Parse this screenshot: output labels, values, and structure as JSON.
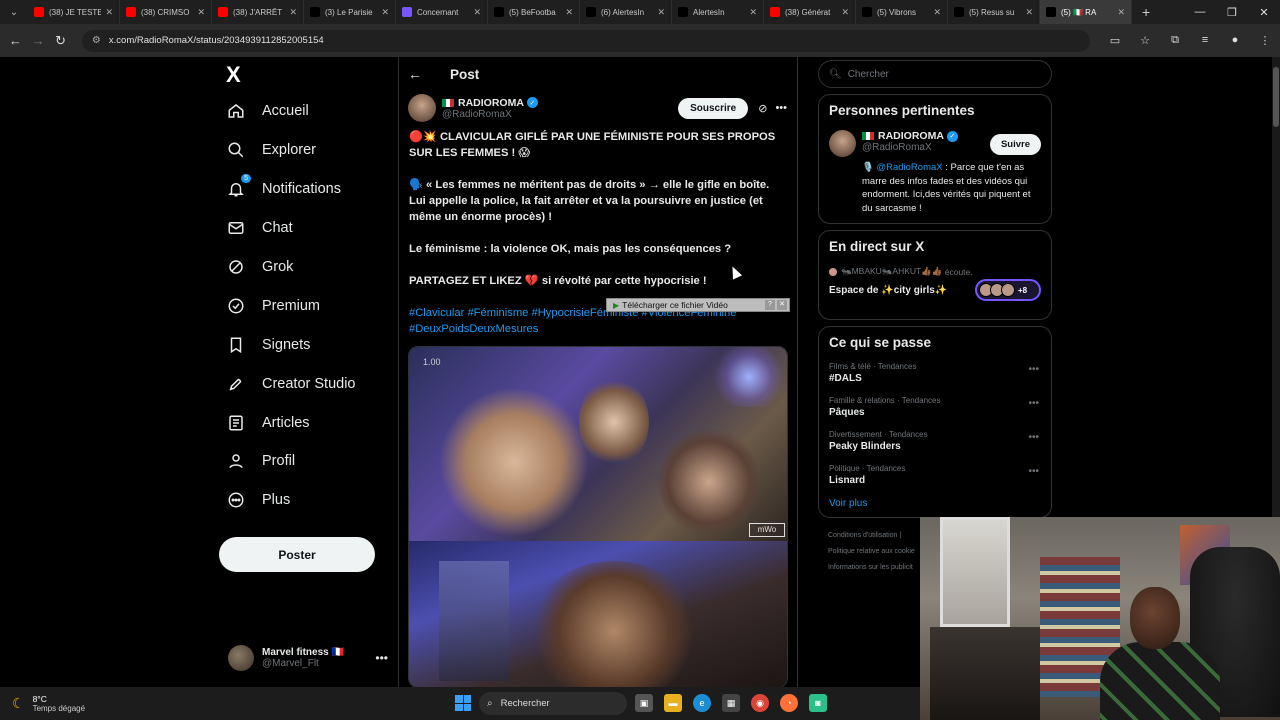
{
  "browser": {
    "tabs": [
      {
        "title": "(38) JE TESTE",
        "favicon_color": "#ff0000"
      },
      {
        "title": "(38) CRIMSO",
        "favicon_color": "#ff0000"
      },
      {
        "title": "(38) J'ARRÊT",
        "favicon_color": "#ff0000"
      },
      {
        "title": "(3) Le Parisie",
        "favicon_color": "#000000"
      },
      {
        "title": "Concernant",
        "favicon_color": "#7856ff"
      },
      {
        "title": "(5) BeFootba",
        "favicon_color": "#000000"
      },
      {
        "title": "(6) AlertesIn",
        "favicon_color": "#000000"
      },
      {
        "title": "AlertesIn",
        "favicon_color": "#000000"
      },
      {
        "title": "(38) Générat",
        "favicon_color": "#ff0000"
      },
      {
        "title": "(5) Vibrons",
        "favicon_color": "#000000"
      },
      {
        "title": "(5) Resus su",
        "favicon_color": "#000000"
      },
      {
        "title": "(5) 🇮🇹 RA",
        "favicon_color": "#000000",
        "active": true
      }
    ],
    "url": "x.com/RadioRomaX/status/2034939112852005154"
  },
  "nav": {
    "logo": "X",
    "items": [
      {
        "label": "Accueil",
        "icon": "home-icon"
      },
      {
        "label": "Explorer",
        "icon": "search-icon"
      },
      {
        "label": "Notifications",
        "icon": "bell-icon",
        "badge": "5"
      },
      {
        "label": "Chat",
        "icon": "mail-icon"
      },
      {
        "label": "Grok",
        "icon": "grok-icon"
      },
      {
        "label": "Premium",
        "icon": "premium-icon"
      },
      {
        "label": "Signets",
        "icon": "bookmark-icon"
      },
      {
        "label": "Creator Studio",
        "icon": "rocket-icon"
      },
      {
        "label": "Articles",
        "icon": "article-icon"
      },
      {
        "label": "Profil",
        "icon": "person-icon"
      },
      {
        "label": "Plus",
        "icon": "more-circle-icon"
      }
    ],
    "post_button": "Poster",
    "account": {
      "name": "Marvel fitness 🇫🇷",
      "handle": "@Marvel_Flt"
    }
  },
  "post": {
    "header_title": "Post",
    "author_name": "RADIOROMA",
    "author_handle": "@RadioRomaX",
    "subscribe_label": "Souscrire",
    "paragraphs": [
      "🔴💥 CLAVICULAR GIFLÉ PAR UNE FÉMINISTE POUR SES PROPOS SUR LES FEMMES ! 😱",
      "🗣️ « Les femmes ne méritent pas de droits » → elle le gifle en boîte. Lui appelle la police, la fait arrêter et va la poursuivre en justice (et même un énorme procès) !",
      "Le féminisme : la violence OK, mais pas les conséquences ?",
      "PARTAGEZ ET LIKEZ 💔 si révolté par cette hypocrisie !"
    ],
    "hashtags": "#Clavicular #Féminisme #HypocrisieFéministe #ViolenceFéminine #DeuxPoidsDeuxMesures",
    "video_speed": "1.00",
    "video_watermark": "mWo",
    "download_bar": "Télécharger ce fichier Vidéo"
  },
  "sidebar": {
    "search_placeholder": "Chercher",
    "relevant": {
      "title": "Personnes pertinentes",
      "name": "RADIOROMA",
      "handle": "@RadioRomaX",
      "follow_label": "Suivre",
      "bio_prefix": "🎙️ ",
      "bio_mention": "@RadioRomaX",
      "bio_text": " : Parce que t'en as marre des infos fades et des vidéos qui endorment. Ici,des vérités qui piquent et du sarcasme !"
    },
    "live": {
      "title": "En direct sur X",
      "meta_name": "🐜MBAKU🐜AHKUT👍🏾👍🏾",
      "meta_action": "écoute.",
      "space_title": "Espace de ✨city girls✨",
      "listeners_extra": "+8"
    },
    "trends": {
      "title": "Ce qui se passe",
      "items": [
        {
          "category": "Films & télé · Tendances",
          "name": "#DALS"
        },
        {
          "category": "Famille & relations · Tendances",
          "name": "Pâques"
        },
        {
          "category": "Divertissement · Tendances",
          "name": "Peaky Blinders"
        },
        {
          "category": "Politique · Tendances",
          "name": "Lisnard"
        }
      ],
      "see_more": "Voir plus"
    },
    "footer": [
      "Conditions d'utilisation  |",
      "Politique relative aux cookie",
      "Informations sur les publicit"
    ]
  },
  "taskbar": {
    "temp": "8°C",
    "weather": "Temps dégagé",
    "search": "Rechercher"
  }
}
